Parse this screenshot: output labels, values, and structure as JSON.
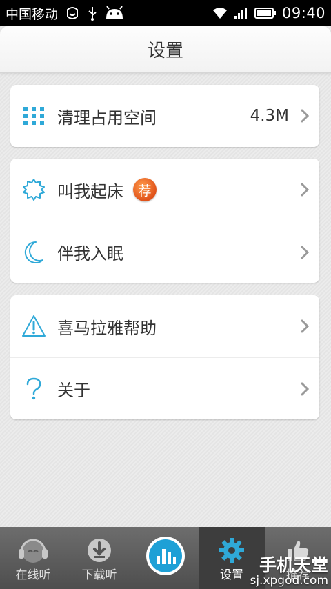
{
  "status_bar": {
    "carrier": "中国移动",
    "time": "09:40"
  },
  "header": {
    "title": "设置"
  },
  "groups": [
    {
      "rows": [
        {
          "label": "清理占用空间",
          "value": "4.3M",
          "icon": "grid-icon"
        }
      ]
    },
    {
      "rows": [
        {
          "label": "叫我起床",
          "badge": "荐",
          "icon": "sun-icon"
        },
        {
          "label": "伴我入眠",
          "icon": "moon-icon"
        }
      ]
    },
    {
      "rows": [
        {
          "label": "喜马拉雅帮助",
          "icon": "warning-icon"
        },
        {
          "label": "关于",
          "icon": "question-icon"
        }
      ]
    }
  ],
  "tabs": [
    {
      "label": "在线听",
      "icon": "headphones-icon"
    },
    {
      "label": "下载听",
      "icon": "download-icon"
    },
    {
      "label": "",
      "icon": "player-icon"
    },
    {
      "label": "设置",
      "icon": "gear-icon",
      "active": true
    },
    {
      "label": "推荐",
      "icon": "thumbs-up-icon"
    }
  ],
  "watermark": {
    "main": "手机天堂",
    "sub": "sj.xpgod.com"
  },
  "colors": {
    "accent": "#2fa9d8",
    "badge": "#e85a1f",
    "text": "#333333"
  }
}
